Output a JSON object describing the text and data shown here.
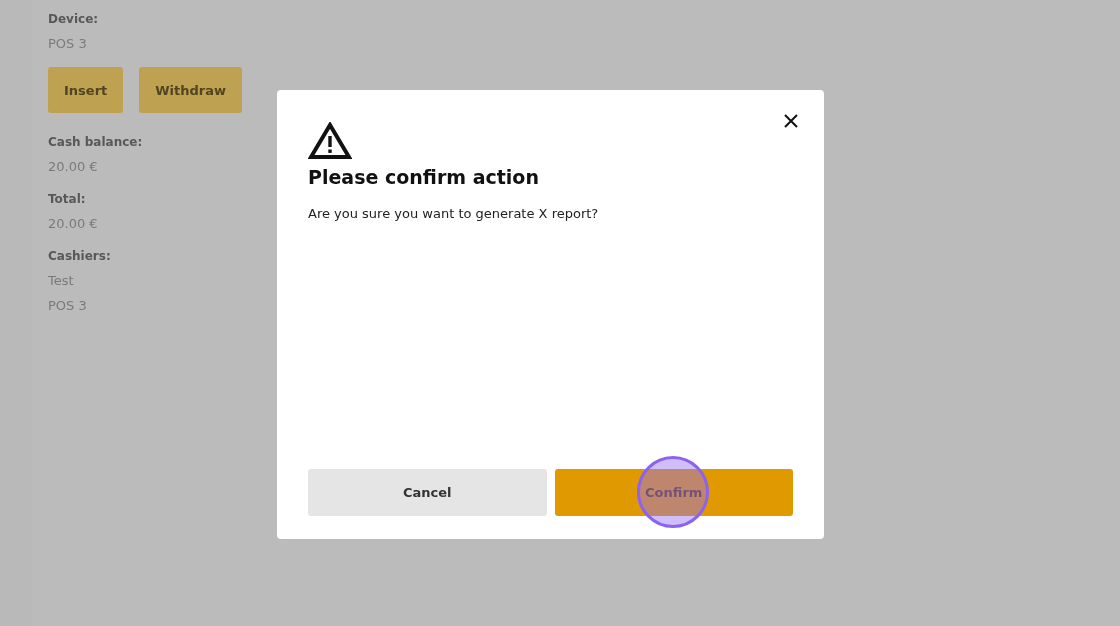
{
  "details": [
    {
      "label": "Device:",
      "values": [
        "POS 3"
      ]
    },
    {
      "label": "Cash balance:",
      "values": [
        "20.00 €"
      ]
    },
    {
      "label": "Total:",
      "values": [
        "20.00 €"
      ]
    },
    {
      "label": "Cashiers:",
      "values": [
        "Test",
        "POS 3"
      ]
    }
  ],
  "actions": [
    "Insert",
    "Withdraw"
  ],
  "dialog": {
    "title": "Please confirm action",
    "message": "Are you sure you want to generate X report?",
    "buttons": [
      {
        "label": "Cancel",
        "kind": "secondary"
      },
      {
        "label": "Confirm",
        "kind": "primary"
      }
    ]
  }
}
